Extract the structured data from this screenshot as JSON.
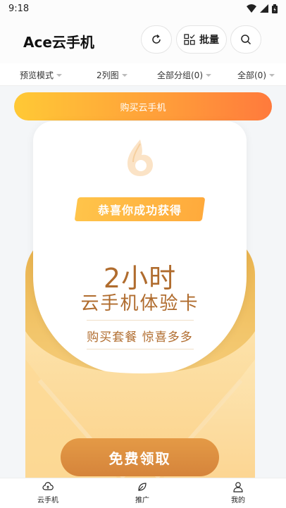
{
  "status_bar": {
    "time": "9:18"
  },
  "header": {
    "title": "Ace云手机",
    "batch_label": "批量"
  },
  "filters": {
    "view_mode": "预览模式",
    "columns": "2列图",
    "group": "全部分组(0)",
    "all": "全部(0)"
  },
  "buy_banner": "购买云手机",
  "reward": {
    "ribbon": "恭喜你成功获得",
    "amount": "2小时",
    "card_name": "云手机体验卡",
    "promo": "购买套餐 惊喜多多",
    "claim_label": "免费领取"
  },
  "bottom_nav": {
    "items": [
      {
        "label": "云手机",
        "icon": "cloud-phone-icon"
      },
      {
        "label": "推广",
        "icon": "leaf-icon"
      },
      {
        "label": "我的",
        "icon": "user-icon"
      }
    ]
  },
  "colors": {
    "accent_orange": "#ff9c3a",
    "reward_brown": "#b06c2e",
    "claim_button": "#d98a3f"
  }
}
